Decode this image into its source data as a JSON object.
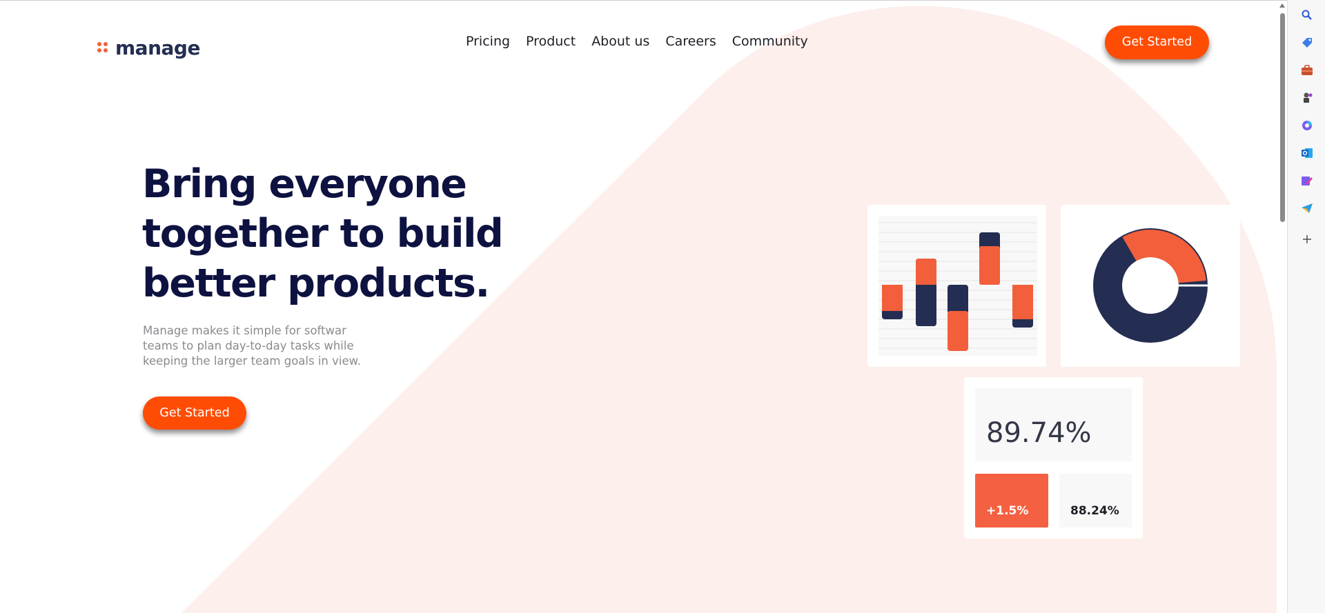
{
  "brand": {
    "name": "manage",
    "accent": "#ff4c04",
    "navy": "#242d52",
    "blob": "#fdefeb"
  },
  "nav": {
    "items": [
      "Pricing",
      "Product",
      "About us",
      "Careers",
      "Community"
    ]
  },
  "header": {
    "cta_label": "Get Started"
  },
  "hero": {
    "title_lines": [
      "Bring everyone",
      "together to build",
      "better products."
    ],
    "subtitle": "Manage makes it simple for softwar teams to plan day-to-day tasks while keeping the larger team goals in view.",
    "cta_label": "Get Started"
  },
  "stats": {
    "main": "89.74%",
    "change": "+1.5%",
    "secondary": "88.24%"
  },
  "sidebar": {
    "icons": [
      "search-icon",
      "tag-icon",
      "briefcase-icon",
      "chess-icon",
      "copilot-icon",
      "outlook-icon",
      "edit-icon",
      "send-icon",
      "plus-icon"
    ]
  }
}
